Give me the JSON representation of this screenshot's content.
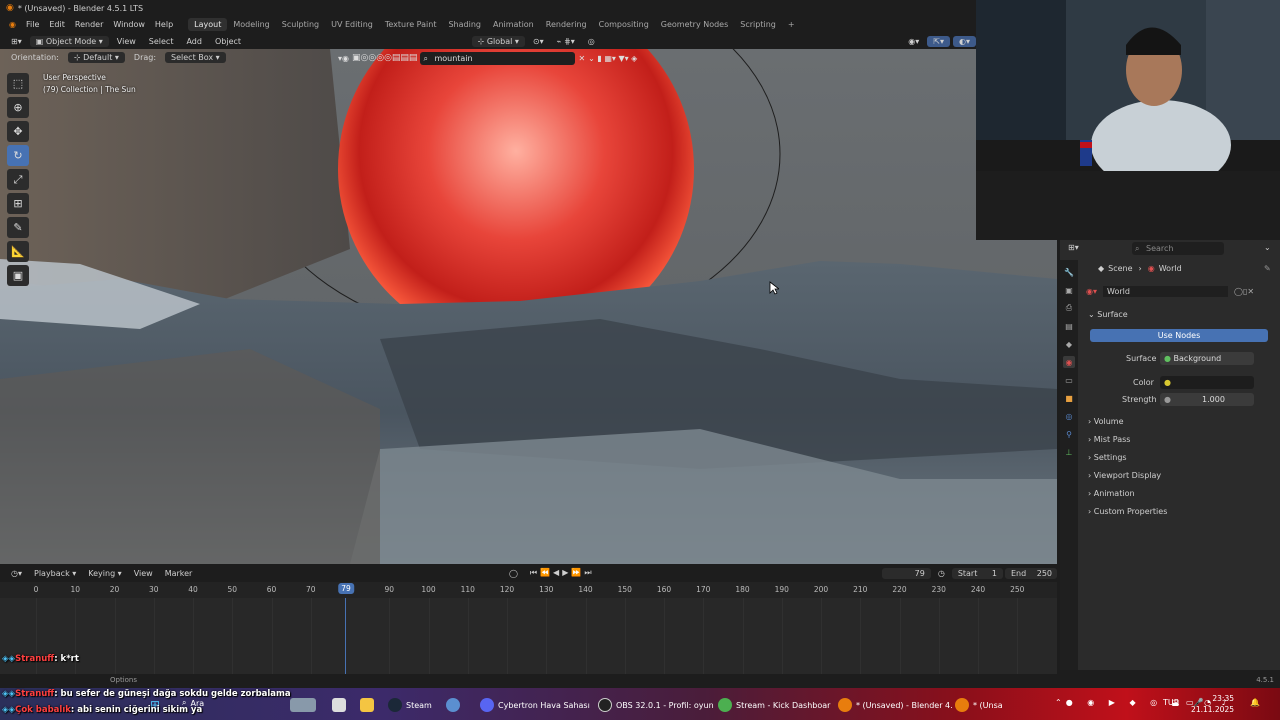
{
  "window": {
    "title": "* (Unsaved) - Blender 4.5.1 LTS"
  },
  "menu": [
    "File",
    "Edit",
    "Render",
    "Window",
    "Help"
  ],
  "workspaces": [
    "Layout",
    "Modeling",
    "Sculpting",
    "UV Editing",
    "Texture Paint",
    "Shading",
    "Animation",
    "Rendering",
    "Compositing",
    "Geometry Nodes",
    "Scripting"
  ],
  "workspace_add": "+",
  "viewport_header": {
    "mode": "Object Mode",
    "menus": [
      "View",
      "Select",
      "Add",
      "Object"
    ],
    "transform_orientation": "Global"
  },
  "tool_header": {
    "orientation_label": "Orientation:",
    "orientation_value": "Default",
    "drag_label": "Drag:",
    "drag_value": "Select Box",
    "search_value": "mountain"
  },
  "viewport_info": {
    "perspective": "User Perspective",
    "collection": "(79) Collection | The Sun"
  },
  "properties": {
    "search_placeholder": "Search",
    "breadcrumb": [
      "Scene",
      "World"
    ],
    "datablock": "World",
    "surface_panel": "Surface",
    "use_nodes": "Use Nodes",
    "surface_label": "Surface",
    "surface_value": "Background",
    "color_label": "Color",
    "strength_label": "Strength",
    "strength_value": "1.000",
    "panels": [
      "Volume",
      "Mist Pass",
      "Settings",
      "Viewport Display",
      "Animation",
      "Custom Properties"
    ]
  },
  "timeline": {
    "menus": [
      "Playback",
      "Keying",
      "View",
      "Marker"
    ],
    "current_frame": "79",
    "start_label": "Start",
    "start_value": "1",
    "end_label": "End",
    "end_value": "250",
    "ticks": [
      "0",
      "10",
      "20",
      "30",
      "40",
      "50",
      "60",
      "70",
      "90",
      "100",
      "110",
      "120",
      "130",
      "140",
      "150",
      "160",
      "170",
      "180",
      "190",
      "200",
      "210",
      "220",
      "230",
      "240",
      "250"
    ],
    "playhead_label": "79"
  },
  "status": {
    "options": "Options",
    "version": "4.5.1"
  },
  "chat": [
    {
      "user": "Stranuff",
      "message": ": k*rt"
    },
    {
      "user": "Stranuff",
      "message": ": bu sefer de güneşi dağa sokdu gelde zorbalama"
    },
    {
      "user": "Çok babalık",
      "message": ": abi senin ciğerini sikim ya"
    }
  ],
  "taskbar": {
    "search": "Ara",
    "items": [
      "Steam",
      "Cybertron Hava Sahası",
      "OBS 32.0.1 - Profil: oyun",
      "Stream - Kick Dashboar",
      "* (Unsaved) - Blender 4.",
      "* (Unsa"
    ],
    "language": "TUR",
    "time": "23:35",
    "date": "21.11.2025"
  },
  "colors": {
    "accent": "#4772b3",
    "sun": "#e8453a",
    "panel_bg": "#2b2b2b"
  }
}
